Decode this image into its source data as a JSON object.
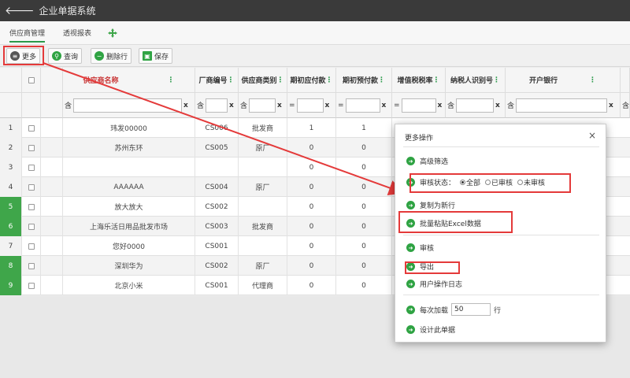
{
  "app": {
    "title": "企业单据系统"
  },
  "tabs": [
    {
      "label": "供应商管理",
      "active": true
    },
    {
      "label": "透视报表",
      "active": false
    }
  ],
  "toolbar": {
    "more_label": "更多",
    "query_label": "查询",
    "delete_label": "删除行",
    "save_label": "保存"
  },
  "columns": [
    "供应商名称",
    "厂商编号",
    "供应商类别",
    "期初应付款",
    "期初预付款",
    "增值税税率",
    "纳税人识别号",
    "开户银行"
  ],
  "filter": {
    "op_contains": "含",
    "op_equals": "=",
    "clear": "x"
  },
  "rows": [
    {
      "n": "1",
      "name": "玮发00000",
      "code": "CS006",
      "cat": "批发商",
      "payable": "1",
      "prepaid": "1"
    },
    {
      "n": "2",
      "name": "苏州东环",
      "code": "CS005",
      "cat": "原厂",
      "payable": "0",
      "prepaid": "0"
    },
    {
      "n": "3",
      "name": "",
      "code": "",
      "cat": "",
      "payable": "0",
      "prepaid": "0"
    },
    {
      "n": "4",
      "name": "AAAAAA",
      "code": "CS004",
      "cat": "原厂",
      "payable": "0",
      "prepaid": "0"
    },
    {
      "n": "5",
      "name": "放大放大",
      "code": "CS002",
      "cat": "",
      "payable": "0",
      "prepaid": "0"
    },
    {
      "n": "6",
      "name": "上海乐活日用品批发市场",
      "code": "CS003",
      "cat": "批发商",
      "payable": "0",
      "prepaid": "0"
    },
    {
      "n": "7",
      "name": "您好0000",
      "code": "CS001",
      "cat": "",
      "payable": "0",
      "prepaid": "0"
    },
    {
      "n": "8",
      "name": "深圳华为",
      "code": "CS002",
      "cat": "原厂",
      "payable": "0",
      "prepaid": "0"
    },
    {
      "n": "9",
      "name": "北京小米",
      "code": "CS001",
      "cat": "代理商",
      "payable": "0",
      "prepaid": "0"
    }
  ],
  "dialog": {
    "title": "更多操作",
    "close": "×",
    "advanced_filter": "高级筛选",
    "audit_status_label": "审核状态：",
    "audit_options": [
      "全部",
      "已审核",
      "未审核"
    ],
    "audit_selected": "全部",
    "copy_new_row": "复制为新行",
    "batch_paste": "批量粘贴Excel数据",
    "audit": "审核",
    "export": "导出",
    "user_log": "用户操作日志",
    "load_prefix": "每次加载",
    "load_value": "50",
    "load_suffix": "行",
    "design": "设计此单据"
  },
  "colors": {
    "topbar": "#3a3a3a",
    "accent_green": "#2fa343",
    "header_red": "#c93636",
    "annotation_red": "#e43a3a"
  }
}
